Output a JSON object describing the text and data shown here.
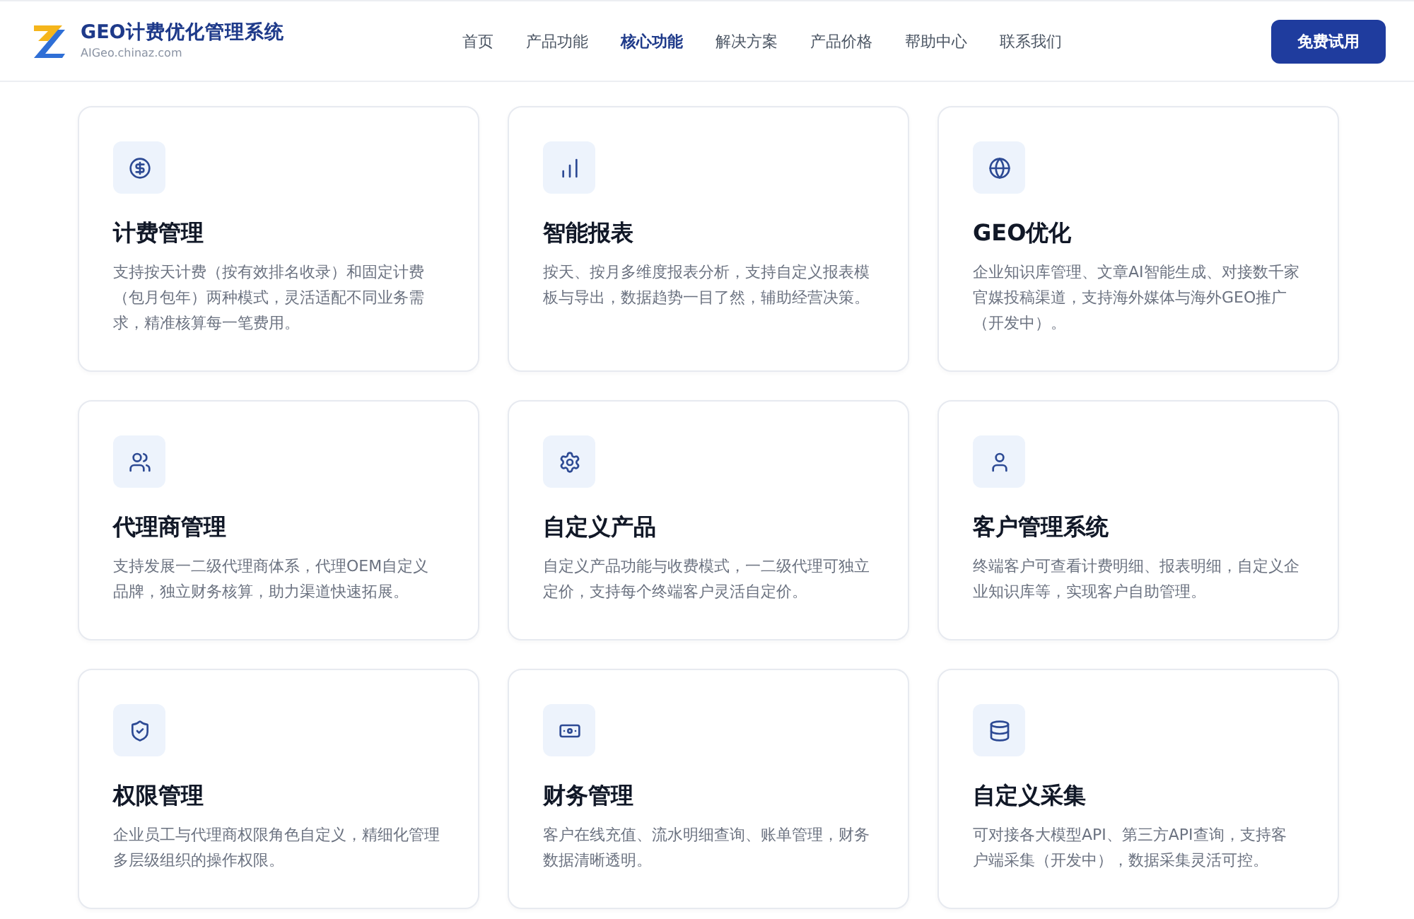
{
  "header": {
    "brand": {
      "name": "GEO计费优化管理系统",
      "domain": "AIGeo.chinaz.com"
    },
    "nav": [
      {
        "label": "首页",
        "selected": false
      },
      {
        "label": "产品功能",
        "selected": false
      },
      {
        "label": "核心功能",
        "selected": true
      },
      {
        "label": "解决方案",
        "selected": false
      },
      {
        "label": "产品价格",
        "selected": false
      },
      {
        "label": "帮助中心",
        "selected": false
      },
      {
        "label": "联系我们",
        "selected": false
      }
    ],
    "cta": "免费试用"
  },
  "features": [
    {
      "title": "计费管理",
      "description": "支持按天计费（按有效排名收录）和固定计费（包月包年）两种模式，灵活适配不同业务需求，精准核算每一笔费用。"
    },
    {
      "title": "智能报表",
      "description": "按天、按月多维度报表分析，支持自定义报表模板与导出，数据趋势一目了然，辅助经营决策。"
    },
    {
      "title": "GEO优化",
      "description": "企业知识库管理、文章AI智能生成、对接数千家官媒投稿渠道，支持海外媒体与海外GEO推广（开发中）。"
    },
    {
      "title": "代理商管理",
      "description": "支持发展一二级代理商体系，代理OEM自定义品牌，独立财务核算，助力渠道快速拓展。"
    },
    {
      "title": "自定义产品",
      "description": "自定义产品功能与收费模式，一二级代理可独立定价，支持每个终端客户灵活自定价。"
    },
    {
      "title": "客户管理系统",
      "description": "终端客户可查看计费明细、报表明细，自定义企业知识库等，实现客户自助管理。"
    },
    {
      "title": "权限管理",
      "description": "企业员工与代理商权限角色自定义，精细化管理多层级组织的操作权限。"
    },
    {
      "title": "财务管理",
      "description": "客户在线充值、流水明细查询、账单管理，财务数据清晰透明。"
    },
    {
      "title": "自定义采集",
      "description": "可对接各大模型API、第三方API查询，支持客户端采集（开发中），数据采集灵活可控。"
    }
  ]
}
